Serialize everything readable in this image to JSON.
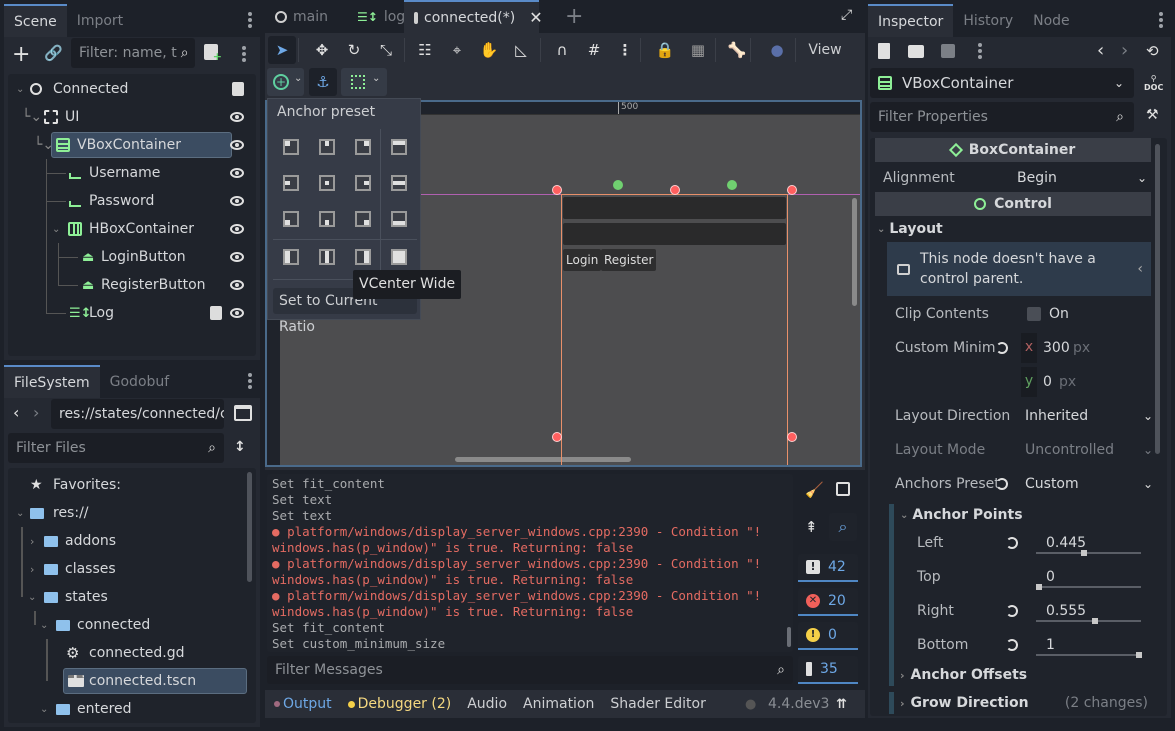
{
  "scene_dock": {
    "tabs": [
      "Scene",
      "Import"
    ],
    "active_tab": "Scene",
    "filter_placeholder": "Filter: name, t",
    "tree": [
      {
        "label": "Connected",
        "icon": "node-circle-icon",
        "depth": 0,
        "has_script": true
      },
      {
        "label": "UI",
        "icon": "canvas-layer-icon",
        "depth": 1
      },
      {
        "label": "VBoxContainer",
        "icon": "vbox-icon",
        "depth": 2,
        "selected": true
      },
      {
        "label": "Username",
        "icon": "line-edit-icon",
        "depth": 3
      },
      {
        "label": "Password",
        "icon": "line-edit-icon",
        "depth": 3
      },
      {
        "label": "HBoxContainer",
        "icon": "hbox-icon",
        "depth": 3
      },
      {
        "label": "LoginButton",
        "icon": "button-icon",
        "depth": 4
      },
      {
        "label": "RegisterButton",
        "icon": "button-icon",
        "depth": 4
      },
      {
        "label": "Log",
        "icon": "rich-text-icon",
        "depth": 3,
        "has_script": true
      }
    ]
  },
  "filesystem_dock": {
    "tabs": [
      "FileSystem",
      "Godobuf"
    ],
    "active_tab": "FileSystem",
    "path": "res://states/connected/c",
    "filter_placeholder": "Filter Files",
    "tree": [
      {
        "label": "Favorites:",
        "icon": "star-icon",
        "depth": 0
      },
      {
        "label": "res://",
        "icon": "folder-icon",
        "depth": 0,
        "expanded": true
      },
      {
        "label": "addons",
        "icon": "folder-icon",
        "depth": 1,
        "expanded": false
      },
      {
        "label": "classes",
        "icon": "folder-icon",
        "depth": 1,
        "expanded": false
      },
      {
        "label": "states",
        "icon": "folder-icon",
        "depth": 1,
        "expanded": true
      },
      {
        "label": "connected",
        "icon": "folder-icon",
        "depth": 2,
        "expanded": true
      },
      {
        "label": "connected.gd",
        "icon": "gear-icon",
        "depth": 3
      },
      {
        "label": "connected.tscn",
        "icon": "scene-icon",
        "depth": 3,
        "selected": true
      },
      {
        "label": "entered",
        "icon": "folder-icon",
        "depth": 2,
        "expanded": true
      }
    ]
  },
  "editor_tabs": [
    {
      "label": "main",
      "icon": "node-circle-icon"
    },
    {
      "label": "log",
      "icon": "rich-text-icon"
    },
    {
      "label": "connected(*)",
      "icon": "node-circle-icon",
      "active": true,
      "closable": true
    }
  ],
  "toolbar": {
    "view_label": "View"
  },
  "anchor_popup": {
    "title": "Anchor preset",
    "set_ratio_label": "Set to Current Ratio",
    "tooltip": "VCenter Wide"
  },
  "viewport": {
    "ruler_label": "500",
    "buttons": [
      "Login",
      "Register"
    ]
  },
  "output": {
    "lines": [
      {
        "text": "Set fit_content",
        "type": "info"
      },
      {
        "text": "Set text",
        "type": "info"
      },
      {
        "text": "Set text",
        "type": "info"
      },
      {
        "text": "platform/windows/display_server_windows.cpp:2390 - Condition \"!",
        "type": "error"
      },
      {
        "text": "windows.has(p_window)\" is true. Returning: false",
        "type": "error-cont"
      },
      {
        "text": "platform/windows/display_server_windows.cpp:2390 - Condition \"!",
        "type": "error"
      },
      {
        "text": "windows.has(p_window)\" is true. Returning: false",
        "type": "error-cont"
      },
      {
        "text": "platform/windows/display_server_windows.cpp:2390 - Condition \"!",
        "type": "error"
      },
      {
        "text": "windows.has(p_window)\" is true. Returning: false",
        "type": "error-cont"
      },
      {
        "text": "Set fit_content",
        "type": "info"
      },
      {
        "text": "Set custom_minimum_size",
        "type": "info"
      }
    ],
    "filter_placeholder": "Filter Messages",
    "counts": {
      "messages": "42",
      "errors": "20",
      "warnings": "0",
      "editor": "35"
    }
  },
  "bottom_panel": {
    "tabs": [
      "Output",
      "Debugger (2)",
      "Audio",
      "Animation",
      "Shader Editor"
    ],
    "version": "4.4.dev3"
  },
  "inspector": {
    "tabs": [
      "Inspector",
      "History",
      "Node"
    ],
    "active_tab": "Inspector",
    "node_name": "VBoxContainer",
    "filter_placeholder": "Filter Properties",
    "sections": {
      "box_container": "BoxContainer",
      "control": "Control",
      "layout": "Layout",
      "anchor_points": "Anchor Points",
      "anchor_offsets": "Anchor Offsets",
      "grow_direction": "Grow Direction",
      "grow_changes": "(2 changes)"
    },
    "alignment": {
      "label": "Alignment",
      "value": "Begin"
    },
    "warning": "This node doesn't have a control parent.",
    "clip_contents": {
      "label": "Clip Contents",
      "value": "On"
    },
    "custom_min": {
      "label": "Custom Minim",
      "x": "300",
      "y": "0",
      "unit": "px"
    },
    "layout_direction": {
      "label": "Layout Direction",
      "value": "Inherited"
    },
    "layout_mode": {
      "label": "Layout Mode",
      "value": "Uncontrolled"
    },
    "anchors_preset": {
      "label": "Anchors Preset",
      "value": "Custom"
    },
    "anchors": [
      {
        "label": "Left",
        "value": "0.445",
        "fraction": 0.445,
        "resettable": true
      },
      {
        "label": "Top",
        "value": "0",
        "fraction": 0,
        "resettable": false
      },
      {
        "label": "Right",
        "value": "0.555",
        "fraction": 0.555,
        "resettable": true
      },
      {
        "label": "Bottom",
        "value": "1",
        "fraction": 1,
        "resettable": true
      }
    ]
  }
}
